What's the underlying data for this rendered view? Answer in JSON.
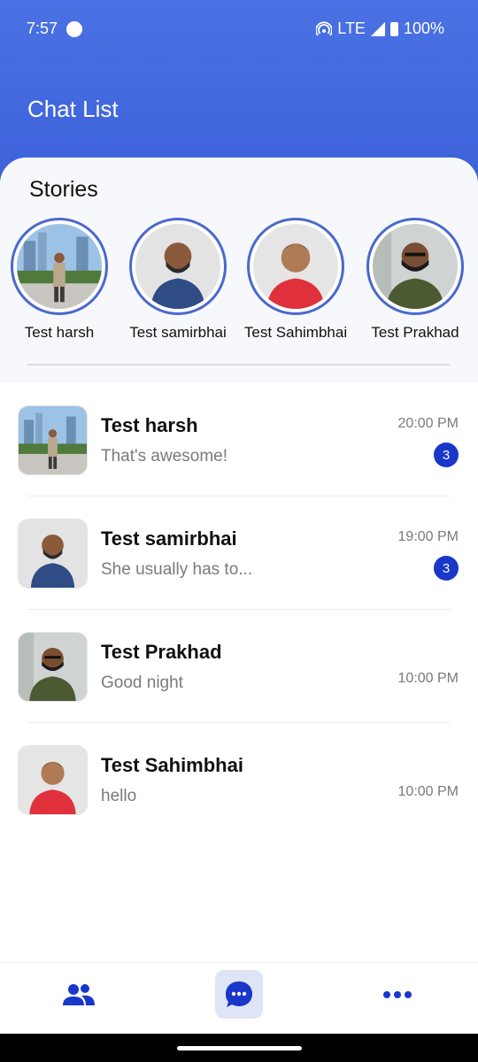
{
  "status_bar": {
    "time": "7:57",
    "network": "LTE",
    "battery": "100%"
  },
  "header": {
    "title": "Chat List"
  },
  "stories": {
    "heading": "Stories",
    "items": [
      {
        "name": "Test harsh"
      },
      {
        "name": "Test samirbhai"
      },
      {
        "name": "Test Sahimbhai"
      },
      {
        "name": "Test Prakhad"
      }
    ]
  },
  "chats": [
    {
      "name": "Test harsh",
      "message": "That's awesome!",
      "time": "20:00 PM",
      "unread": "3"
    },
    {
      "name": "Test samirbhai",
      "message": "She usually has to...",
      "time": "19:00 PM",
      "unread": "3"
    },
    {
      "name": "Test Prakhad",
      "message": "Good night",
      "time": "10:00 PM",
      "unread": ""
    },
    {
      "name": "Test Sahimbhai",
      "message": "hello",
      "time": "10:00 PM",
      "unread": ""
    }
  ],
  "bottom_nav": {
    "items": [
      {
        "icon": "users-icon",
        "active": false
      },
      {
        "icon": "chat-bubble-icon",
        "active": true
      },
      {
        "icon": "more-horizontal-icon",
        "active": false
      }
    ]
  },
  "colors": {
    "header": "#4a72e4",
    "accent": "#1937c9",
    "story_ring": "#4a68cf"
  }
}
